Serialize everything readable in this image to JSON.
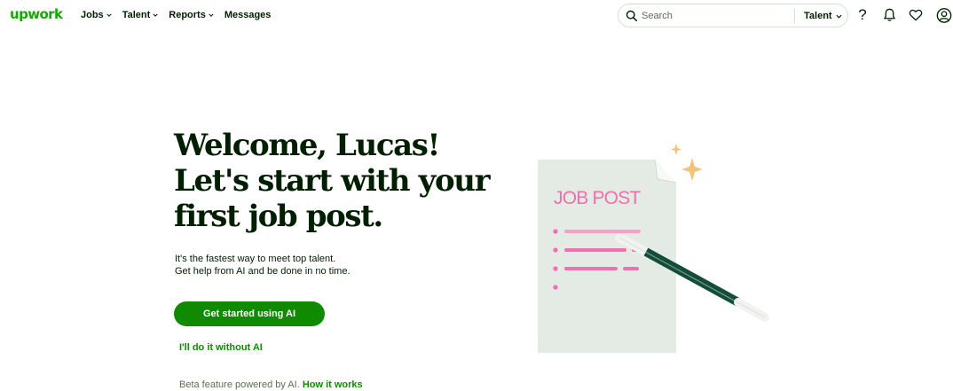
{
  "header": {
    "logo": "upwork",
    "nav": [
      {
        "label": "Jobs",
        "has_dropdown": true
      },
      {
        "label": "Talent",
        "has_dropdown": true
      },
      {
        "label": "Reports",
        "has_dropdown": true
      },
      {
        "label": "Messages",
        "has_dropdown": false
      }
    ],
    "search": {
      "placeholder": "Search",
      "value": "",
      "scope": "Talent"
    },
    "icons": [
      "help-icon",
      "bell-icon",
      "heart-icon",
      "account-icon"
    ]
  },
  "hero": {
    "title_lines": [
      "Welcome, Lucas!",
      "Let's start with your",
      "first job post."
    ],
    "subtitle_lines": [
      "It's the fastest way to meet top talent.",
      "Get help from AI and be done in no time."
    ],
    "primary_button": "Get started using AI",
    "secondary_link": "I'll do it without AI",
    "beta_text": "Beta feature powered by AI.",
    "beta_link": "How it works"
  },
  "illustration": {
    "heading": "JOB POST",
    "icons": [
      "job-post-document-icon",
      "sparkle-icon",
      "pen-icon"
    ]
  },
  "colors": {
    "brand_green": "#14a800",
    "button_green": "#108a00",
    "text_dark": "#001e00",
    "text_muted": "#5e6d55",
    "paper": "#e4ebe4",
    "ink_pink": "#f06fae",
    "pen_dark": "#144c3a",
    "sparkle": "#f2c47a"
  }
}
